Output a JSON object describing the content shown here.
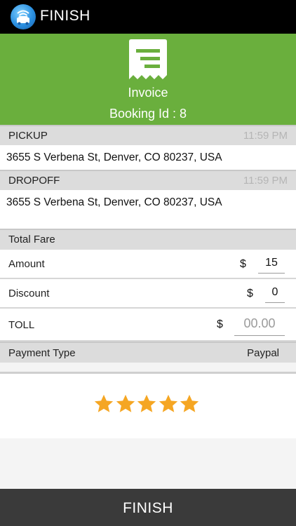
{
  "appbar": {
    "title": "FINISH",
    "logo_icon": "car-app-logo-icon"
  },
  "hero": {
    "icon": "receipt-icon",
    "title": "Invoice",
    "booking": "Booking Id : 8",
    "background": "#6aaf3d"
  },
  "pickup": {
    "label": "PICKUP",
    "time": "11:59 PM",
    "address": "3655 S Verbena St, Denver, CO 80237, USA"
  },
  "dropoff": {
    "label": "DROPOFF",
    "time": "11:59 PM",
    "address": "3655 S Verbena St, Denver, CO 80237, USA"
  },
  "fare": {
    "header": "Total Fare",
    "amount": {
      "label": "Amount",
      "currency": "$",
      "value": "15"
    },
    "discount": {
      "label": "Discount",
      "currency": "$",
      "value": "0"
    },
    "toll": {
      "label": "TOLL",
      "currency": "$",
      "placeholder": "00.00"
    }
  },
  "payment": {
    "label": "Payment Type",
    "value": "Paypal"
  },
  "rating": {
    "stars": 5,
    "max": 5,
    "color": "#f5a623"
  },
  "footer": {
    "button_label": "FINISH",
    "background": "#3a3a3a"
  }
}
